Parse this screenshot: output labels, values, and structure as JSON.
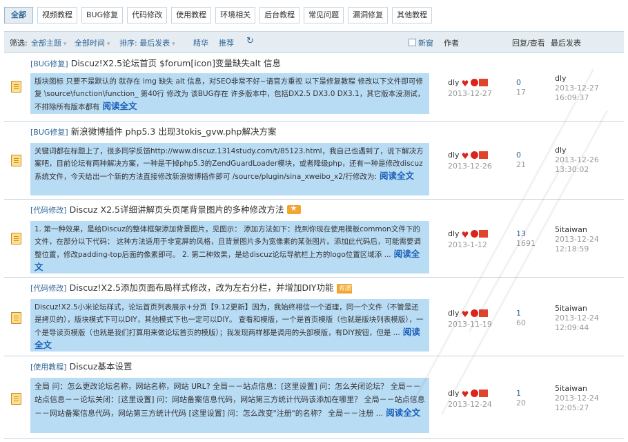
{
  "tabs": [
    "全部",
    "视频教程",
    "BUG修复",
    "代码修改",
    "使用教程",
    "环境相关",
    "后台教程",
    "常见问题",
    "漏洞修复",
    "其他教程"
  ],
  "filter": {
    "label": "筛选:",
    "all_topics": "全部主题",
    "all_time": "全部时间",
    "sort": "排序: 最后发表",
    "digest": "精华",
    "recommend": "推荐",
    "refresh_icon": "refresh-icon",
    "new_window": "新窗",
    "col_author": "作者",
    "col_replies": "回复/查看",
    "col_last": "最后发表"
  },
  "threads": [
    {
      "category": "[BUG修复]",
      "subject": "Discuz!X2.5论坛首页 $forum[icon]变量缺失alt 信息",
      "excerpt": "版块图标 只要不是默认的 就存在 img 缺失 alt 信息，对SEO非常不好~请官方重视 以下是修复教程 修改以下文件即可修复 \\source\\function\\function_ 第40行 修改为 该BUG存在 许多版本中，包括DX2.5 DX3.0 DX3.1，其它版本没测试，不排除所有版本都有",
      "read_more": "阅读全文",
      "author": "dly",
      "date": "2013-12-27",
      "replies": "0",
      "views": "17",
      "last_user": "dly",
      "last_date": "2013-12-27",
      "last_time": "16:09:37"
    },
    {
      "category": "[BUG修复]",
      "subject": "新浪微博插件 php5.3 出现3tokis_gvw.php解决方案",
      "excerpt": "关键词都在标题上了，很多同学反馈http://www.discuz.1314study.com/t/85123.html，我自己也遇到了，说下解决方案吧，目前论坛有两种解决方案，一种是干掉php5.3的ZendGuardLoader模块，或者降级php，还有一种是修改discuz系统文件，今天给出一个新的方法直接修改新浪微博插件即可 /source/plugin/sina_xweibo_x2/行修改为:",
      "read_more": "阅读全文",
      "author": "dly",
      "date": "2013-12-26",
      "replies": "0",
      "views": "21",
      "last_user": "dly",
      "last_date": "2013-12-26",
      "last_time": "13:30:02"
    },
    {
      "category": "[代码修改]",
      "subject": "Discuz X2.5详细讲解页头页尾背景图片的多种修改方法",
      "excerpt": "1. 第一种效果，是给Discuz的整体框架添加背景图片，见图示： 添加方法如下：找到你现在使用模板common文件下的文件，在部分以下代码： 这种方法适用于非宽屏的风格，且背景图片多为宽像素的某张图片。添加此代码后，可能需要调整位置，修改padding-top后面的像素即可。 2. 第二种效果，是给discuz论坛导航栏上方的logo位置区域添 ...",
      "read_more": "阅读全文",
      "author": "dly",
      "date": "2013-1-12",
      "replies": "13",
      "views": "1691",
      "last_user": "5itaiwan",
      "last_date": "2013-12-24",
      "last_time": "12:18:59"
    },
    {
      "category": "[代码修改]",
      "subject": "Discuz!X2.5添加页面布局样式修改，改为左右分栏，并增加DIY功能",
      "badge": "有图",
      "excerpt": "Discuz!X2.5小米论坛样式，论坛首页列表展示+分页【9.12更新】因为，我始终相信一个道理，同一个文件（不管是还是拷贝的），版块模式下可以DIY，其他模式下也一定可以DIY。 查看和模版，一个是首页模版（也就是版块列表模版），一个是导读页模版（也就是我们打算用来做论坛首页的模版）；我发现两样都是调用的头部模版，有DIY按钮，但是 ...",
      "read_more": "阅读全文",
      "author": "dly",
      "date": "2013-11-19",
      "replies": "1",
      "views": "60",
      "last_user": "5itaiwan",
      "last_date": "2013-12-24",
      "last_time": "12:09:44"
    },
    {
      "category": "[使用教程]",
      "subject": "Discuz基本设置",
      "excerpt": "全局 问：怎么更改论坛名称，网站名称，网站 URL? 全局－－站点信息：[这里设置] 问：怎么关闭论坛？ 全局－－站点信息－－论坛关闭：[这里设置] 问：网站备案信息代码，网站第三方统计代码该添加在哪里？ 全局－－站点信息－－网站备案信息代码，网站第三方统计代码 [这里设置] 问：怎么改变\"注册\"的名称？ 全局－－注册 ...",
      "read_more": "阅读全文",
      "author": "dly",
      "date": "2013-12-24",
      "replies": "1",
      "views": "20",
      "last_user": "5itaiwan",
      "last_date": "2013-12-24",
      "last_time": "12:05:27"
    }
  ]
}
